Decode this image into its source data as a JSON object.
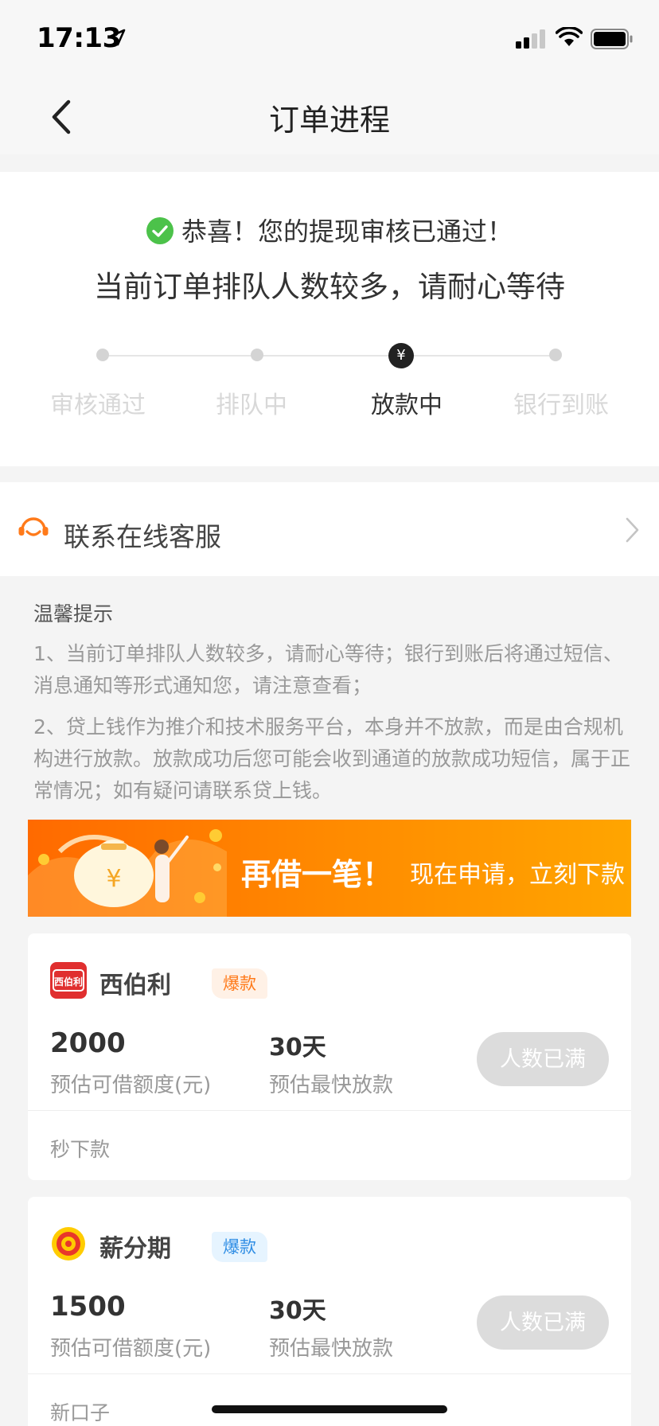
{
  "status_bar": {
    "time": "17:13"
  },
  "nav": {
    "title": "订单进程"
  },
  "status": {
    "success_message": "恭喜！您的提现审核已通过！",
    "wait_message": "当前订单排队人数较多，请耐心等待",
    "active_step_symbol": "¥",
    "steps": [
      {
        "label": "审核通过",
        "active": false
      },
      {
        "label": "排队中",
        "active": false
      },
      {
        "label": "放款中",
        "active": true
      },
      {
        "label": "银行到账",
        "active": false
      }
    ]
  },
  "service": {
    "label": "联系在线客服"
  },
  "tips": {
    "title": "温馨提示",
    "items": [
      "1、当前订单排队人数较多，请耐心等待；银行到账后将通过短信、消息通知等形式通知您，请注意查看；",
      "2、贷上钱作为推介和技术服务平台，本身并不放款，而是由合规机构进行放款。放款成功后您可能会收到通道的放款成功短信，属于正常情况；如有疑问请联系贷上钱。"
    ]
  },
  "banner": {
    "title": "再借一笔！",
    "subtitle": "现在申请，立刻下款",
    "money_symbol": "¥"
  },
  "products": [
    {
      "name": "西伯利",
      "logo_text": "西伯利",
      "badge": "爆款",
      "amount": "2000",
      "amount_label": "预估可借额度(元)",
      "days": "30天",
      "days_label": "预估最快放款",
      "button": "人数已满",
      "footer": "秒下款"
    },
    {
      "name": "薪分期",
      "badge": "爆款",
      "amount": "1500",
      "amount_label": "预估可借额度(元)",
      "days": "30天",
      "days_label": "预估最快放款",
      "button": "人数已满",
      "footer": "新口子"
    }
  ],
  "colors": {
    "accent_orange": "#ff7a1a",
    "success_green": "#4cc24a",
    "badge_blue": "#2f8de4",
    "disabled_button": "#dcdcdc"
  }
}
